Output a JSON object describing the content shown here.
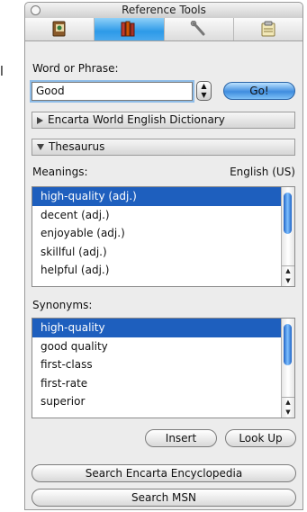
{
  "stray_char": "l",
  "window": {
    "title": "Reference Tools"
  },
  "toolbar": {
    "tabs": [
      {
        "icon": "reference-book-icon"
      },
      {
        "icon": "books-icon",
        "active": true
      },
      {
        "icon": "wrench-icon"
      },
      {
        "icon": "clipboard-icon"
      }
    ]
  },
  "search": {
    "label": "Word or Phrase:",
    "value": "Good",
    "go_label": "Go!"
  },
  "dictionary": {
    "label": "Encarta World English Dictionary",
    "expanded": false
  },
  "thesaurus": {
    "label": "Thesaurus",
    "expanded": true
  },
  "meanings": {
    "label": "Meanings:",
    "language": "English (US)",
    "items": [
      "high-quality (adj.)",
      "decent (adj.)",
      "enjoyable (adj.)",
      "skillful (adj.)",
      "helpful (adj.)"
    ],
    "selected_index": 0
  },
  "synonyms": {
    "label": "Synonyms:",
    "items": [
      "high-quality",
      "good quality",
      "first-class",
      "first-rate",
      "superior"
    ],
    "selected_index": 0
  },
  "actions": {
    "insert": "Insert",
    "look_up": "Look Up"
  },
  "footer": {
    "search_encarta": "Search Encarta Encyclopedia",
    "search_msn": "Search MSN"
  },
  "colors": {
    "selection": "#1e5fbe",
    "accent": "#3f8ddf"
  }
}
